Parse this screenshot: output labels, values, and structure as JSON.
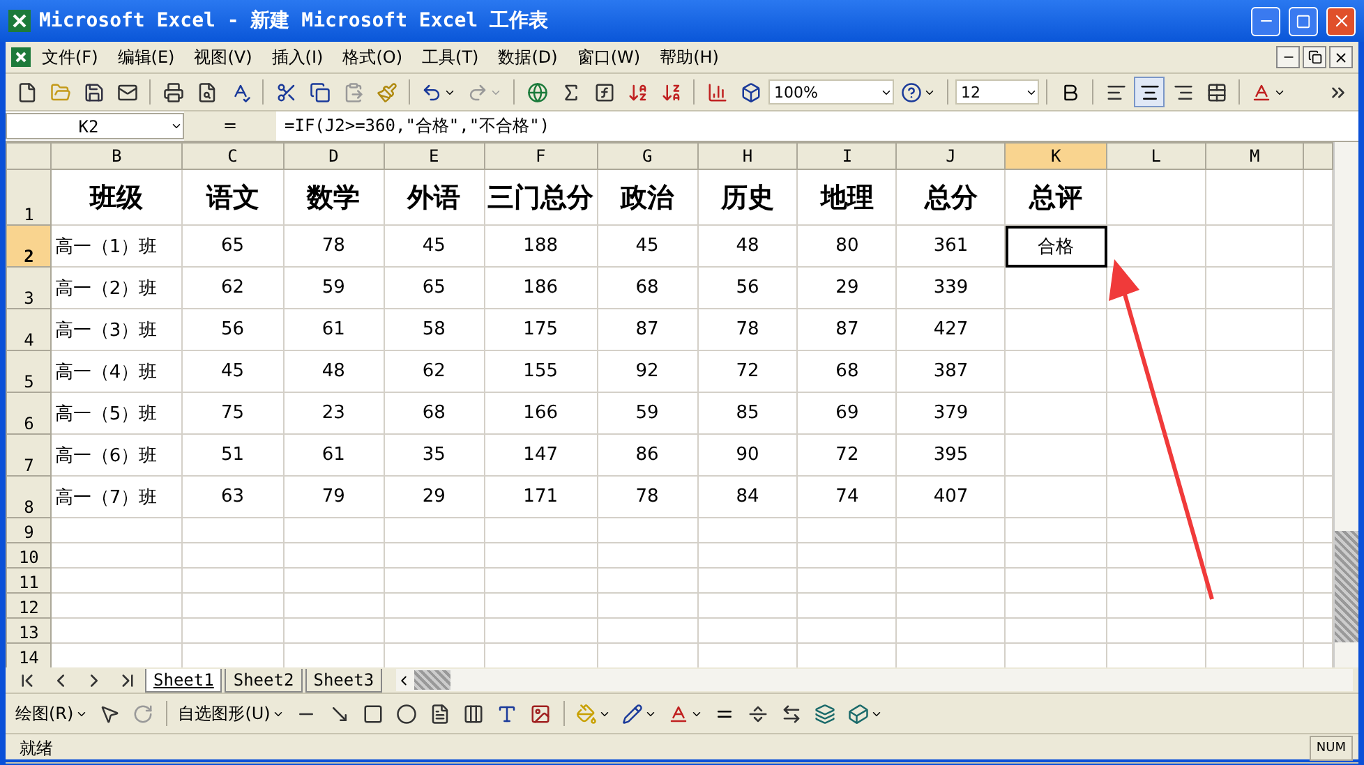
{
  "window": {
    "title": "Microsoft Excel - 新建 Microsoft Excel 工作表"
  },
  "menu": [
    "文件(F)",
    "编辑(E)",
    "视图(V)",
    "插入(I)",
    "格式(O)",
    "工具(T)",
    "数据(D)",
    "窗口(W)",
    "帮助(H)"
  ],
  "toolbar": {
    "zoom": "100%",
    "font_size": "12"
  },
  "formula_bar": {
    "name_box": "K2",
    "equals": "=",
    "formula": "=IF(J2>=360,\"合格\",\"不合格\")"
  },
  "columns": [
    {
      "label": "B",
      "selected": false
    },
    {
      "label": "C",
      "selected": false
    },
    {
      "label": "D",
      "selected": false
    },
    {
      "label": "E",
      "selected": false
    },
    {
      "label": "F",
      "selected": false
    },
    {
      "label": "G",
      "selected": false
    },
    {
      "label": "H",
      "selected": false
    },
    {
      "label": "I",
      "selected": false
    },
    {
      "label": "J",
      "selected": false
    },
    {
      "label": "K",
      "selected": true
    },
    {
      "label": "L",
      "selected": false
    },
    {
      "label": "M",
      "selected": false
    }
  ],
  "rows": [
    {
      "label": "1",
      "selected": false,
      "kind": "header",
      "cells": [
        "班级",
        "语文",
        "数学",
        "外语",
        "三门总分",
        "政治",
        "历史",
        "地理",
        "总分",
        "总评",
        "",
        ""
      ]
    },
    {
      "label": "2",
      "selected": true,
      "kind": "data",
      "cells": [
        "高一（1）班",
        "65",
        "78",
        "45",
        "188",
        "45",
        "48",
        "80",
        "361",
        "合格",
        "",
        ""
      ]
    },
    {
      "label": "3",
      "selected": false,
      "kind": "data",
      "cells": [
        "高一（2）班",
        "62",
        "59",
        "65",
        "186",
        "68",
        "56",
        "29",
        "339",
        "",
        "",
        ""
      ]
    },
    {
      "label": "4",
      "selected": false,
      "kind": "data",
      "cells": [
        "高一（3）班",
        "56",
        "61",
        "58",
        "175",
        "87",
        "78",
        "87",
        "427",
        "",
        "",
        ""
      ]
    },
    {
      "label": "5",
      "selected": false,
      "kind": "data",
      "cells": [
        "高一（4）班",
        "45",
        "48",
        "62",
        "155",
        "92",
        "72",
        "68",
        "387",
        "",
        "",
        ""
      ]
    },
    {
      "label": "6",
      "selected": false,
      "kind": "data",
      "cells": [
        "高一（5）班",
        "75",
        "23",
        "68",
        "166",
        "59",
        "85",
        "69",
        "379",
        "",
        "",
        ""
      ]
    },
    {
      "label": "7",
      "selected": false,
      "kind": "data",
      "cells": [
        "高一（6）班",
        "51",
        "61",
        "35",
        "147",
        "86",
        "90",
        "72",
        "395",
        "",
        "",
        ""
      ]
    },
    {
      "label": "8",
      "selected": false,
      "kind": "data",
      "cells": [
        "高一（7）班",
        "63",
        "79",
        "29",
        "171",
        "78",
        "84",
        "74",
        "407",
        "",
        "",
        ""
      ]
    },
    {
      "label": "9",
      "selected": false,
      "kind": "empty",
      "cells": []
    },
    {
      "label": "10",
      "selected": false,
      "kind": "empty",
      "cells": []
    },
    {
      "label": "11",
      "selected": false,
      "kind": "empty",
      "cells": []
    },
    {
      "label": "12",
      "selected": false,
      "kind": "empty",
      "cells": []
    },
    {
      "label": "13",
      "selected": false,
      "kind": "empty",
      "cells": []
    },
    {
      "label": "14",
      "selected": false,
      "kind": "empty",
      "cells": []
    }
  ],
  "sheet_tabs": [
    {
      "label": "Sheet1",
      "selected": true
    },
    {
      "label": "Sheet2",
      "selected": false
    },
    {
      "label": "Sheet3",
      "selected": false
    }
  ],
  "drawing_toolbar": {
    "draw_menu": "绘图(R)",
    "autoshapes": "自选图形(U)"
  },
  "status_bar": {
    "status": "就绪",
    "num": "NUM"
  }
}
